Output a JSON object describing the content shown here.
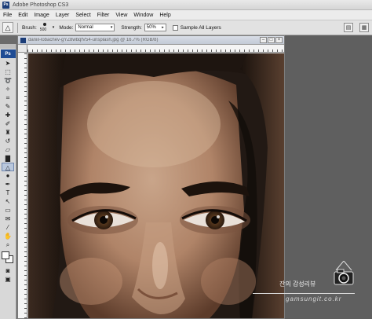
{
  "titlebar": {
    "title": "Adobe Photoshop CS3",
    "logo": "Ps"
  },
  "menu": [
    "File",
    "Edit",
    "Image",
    "Layer",
    "Select",
    "Filter",
    "View",
    "Window",
    "Help"
  ],
  "options": {
    "brush_label": "Brush:",
    "brush_size": "500",
    "mode_label": "Mode:",
    "mode_value": "Normal",
    "strength_label": "Strength:",
    "strength_value": "50%",
    "sample_all_layers": "Sample All Layers"
  },
  "toolbox": {
    "logo": "Ps"
  },
  "document": {
    "title": "daniil-lobachev-gYZ8wbqfV54-unsplash.jpg @ 16.7% (RGB/8)"
  },
  "watermark": {
    "korean": "잔의 감성리뷰",
    "url": "gamsungit.co.kr"
  },
  "colors": {
    "foreground": "#ffffff",
    "background": "#f8f8f8",
    "accent": "#1f4c94"
  }
}
